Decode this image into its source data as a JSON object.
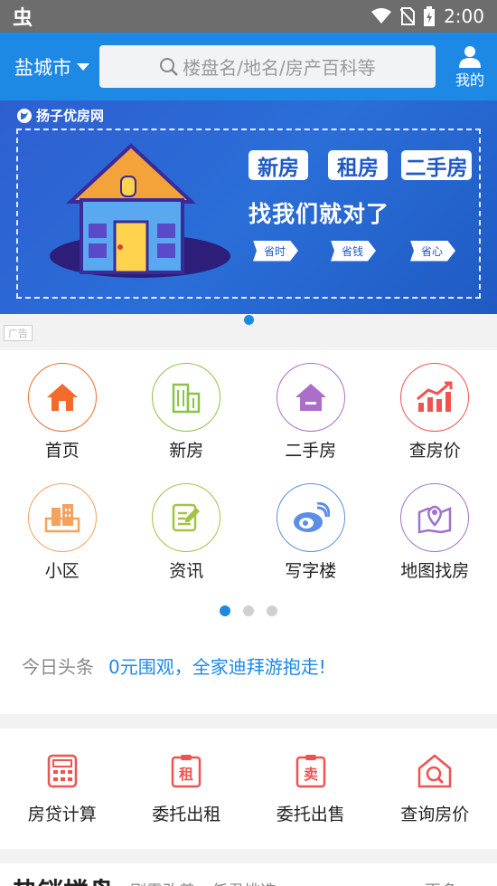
{
  "status_bar": {
    "time": "2:00",
    "app_icon": "虫"
  },
  "header": {
    "city": "盐城市",
    "search_placeholder": "楼盘名/地名/房产百科等",
    "mine_label": "我的"
  },
  "banner": {
    "brand": "扬子优房网",
    "tags": [
      "新房",
      "租房",
      "二手房"
    ],
    "slogan": "找我们就对了",
    "arrows": [
      "省时",
      "省钱",
      "省心"
    ],
    "ad_label": "广告"
  },
  "nav_grid": [
    {
      "label": "首页",
      "icon": "home-icon",
      "color": "#f26b2a"
    },
    {
      "label": "新房",
      "icon": "building-icon",
      "color": "#8bc34a"
    },
    {
      "label": "二手房",
      "icon": "house-icon",
      "color": "#ab6ec9"
    },
    {
      "label": "查房价",
      "icon": "chart-up-icon",
      "color": "#ef5350"
    },
    {
      "label": "小区",
      "icon": "community-icon",
      "color": "#f5a25d"
    },
    {
      "label": "资讯",
      "icon": "news-icon",
      "color": "#a4c246"
    },
    {
      "label": "写字楼",
      "icon": "office-icon",
      "color": "#5b8ee6"
    },
    {
      "label": "地图找房",
      "icon": "map-icon",
      "color": "#9e74c8"
    }
  ],
  "headline": {
    "label": "今日头条",
    "text": "0元围观，全家迪拜游抱走!"
  },
  "services": [
    {
      "label": "房贷计算",
      "icon": "calculator-icon"
    },
    {
      "label": "委托出租",
      "icon": "rent-icon",
      "glyph": "租"
    },
    {
      "label": "委托出售",
      "icon": "sell-icon",
      "glyph": "卖"
    },
    {
      "label": "查询房价",
      "icon": "price-query-icon"
    }
  ],
  "hot": {
    "title": "热销楼盘",
    "subtitle": "刚需改善，任君挑选",
    "more": "更多>>"
  },
  "colors": {
    "primary": "#1e88e5",
    "service_red": "#ef5350"
  }
}
